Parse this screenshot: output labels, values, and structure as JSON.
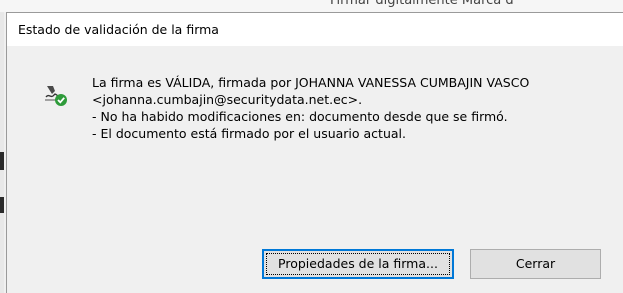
{
  "background": {
    "toolbar_text": "Firmar digitalmente   Marca d"
  },
  "dialog": {
    "title": "Estado de validación de la firma",
    "status_icon": "signature-valid-check-icon",
    "message_lines": [
      "La firma es VÁLIDA, firmada por JOHANNA VANESSA CUMBAJIN VASCO",
      "<johanna.cumbajin@securitydata.net.ec>.",
      "- No ha habido modificaciones en: documento desde que se firmó.",
      "- El documento está firmado por el usuario actual."
    ],
    "buttons": {
      "properties_label": "Propiedades de la firma...",
      "close_label": "Cerrar"
    }
  },
  "colors": {
    "accent": "#0078d7",
    "valid_check": "#2e9b3a",
    "dialog_bg": "#f0f0f0",
    "titlebar_bg": "#ffffff"
  }
}
